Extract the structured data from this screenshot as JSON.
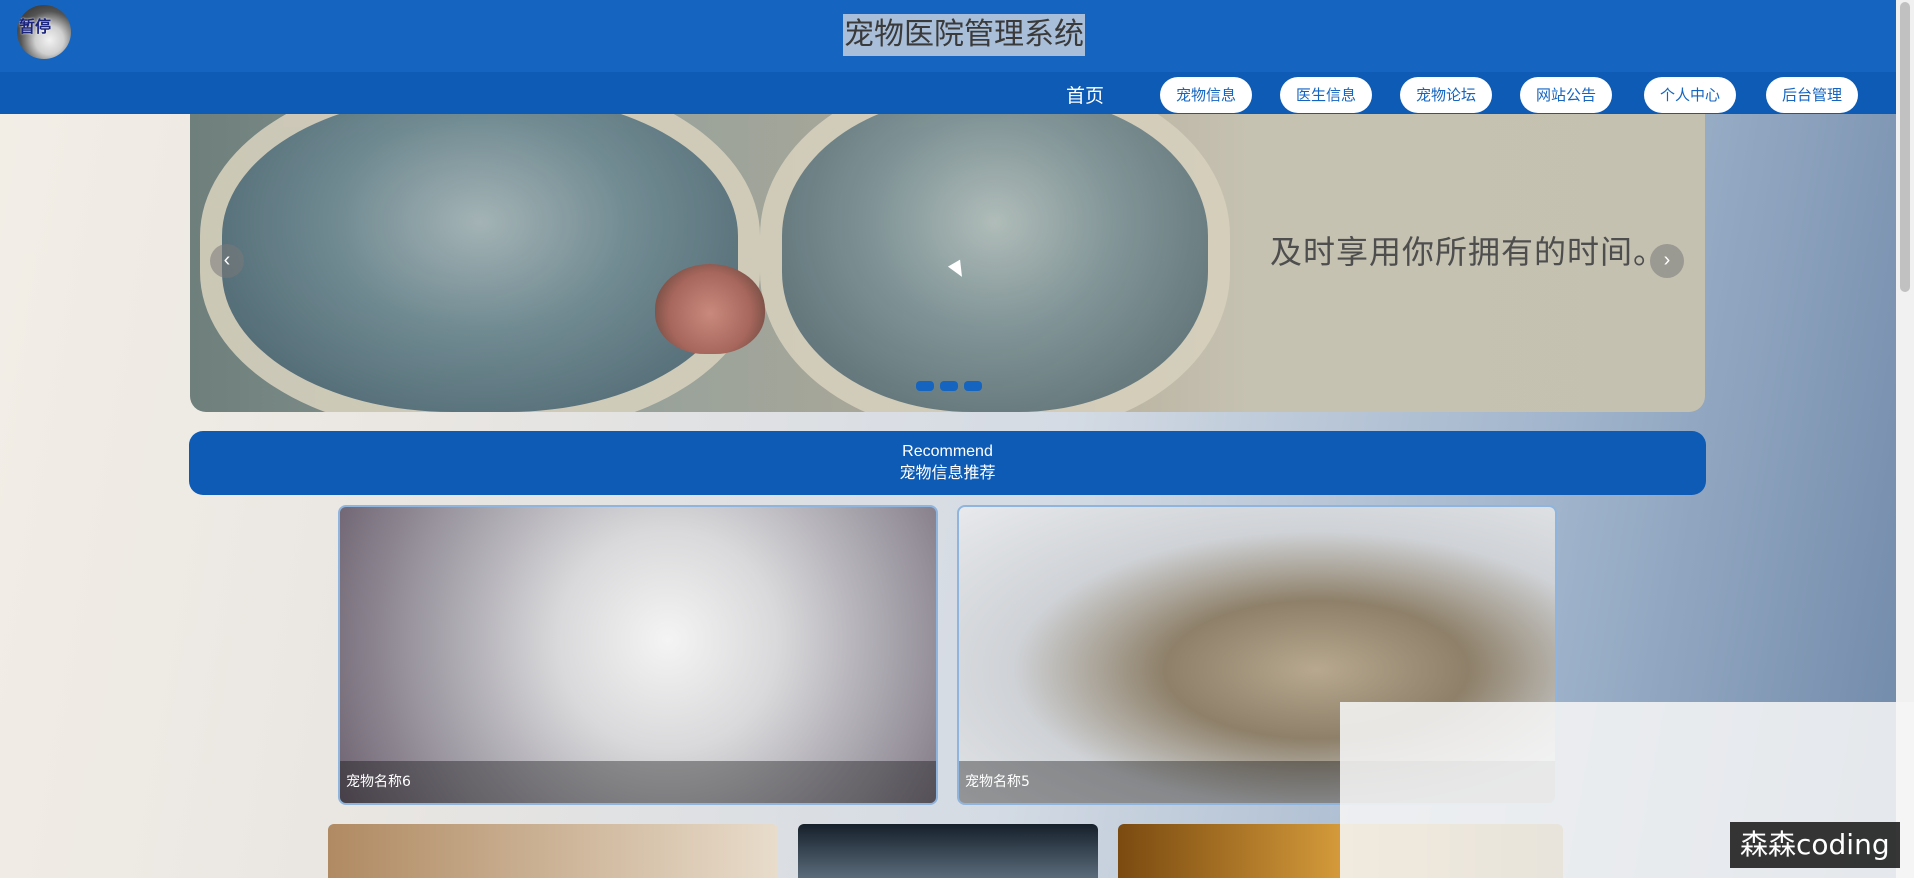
{
  "header": {
    "logo_text": "暂停",
    "title": "宠物医院管理系统"
  },
  "nav": {
    "home": "首页",
    "items": [
      "宠物信息",
      "医生信息",
      "宠物论坛",
      "网站公告",
      "个人中心",
      "后台管理"
    ]
  },
  "banner": {
    "caption": "及时享用你所拥有的时间。",
    "prev_icon": "chevron-left-icon",
    "next_icon": "chevron-right-icon",
    "slide_count": 3
  },
  "recommend": {
    "title_en": "Recommend",
    "title_cn": "宠物信息推荐",
    "cards": [
      {
        "name": "宠物名称6"
      },
      {
        "name": "宠物名称5"
      }
    ]
  },
  "watermark": "森森coding",
  "colors": {
    "primary": "#1565c0",
    "nav": "#0d5bb5"
  }
}
